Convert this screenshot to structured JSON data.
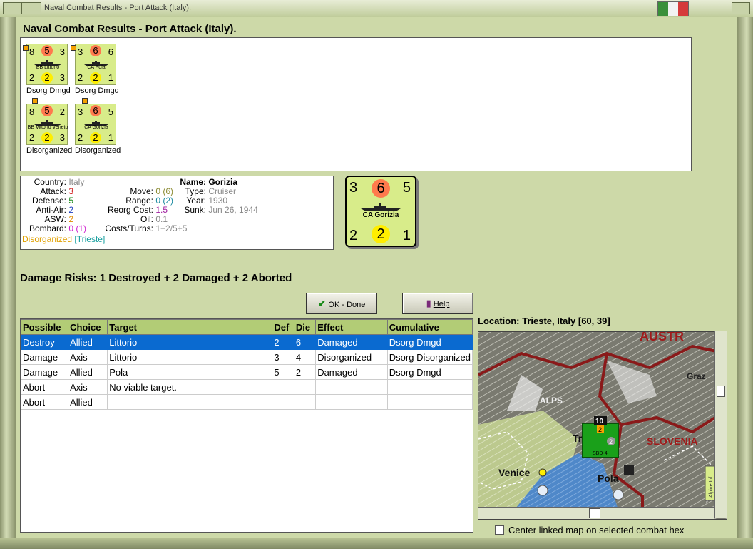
{
  "window": {
    "title": "Naval Combat Results - Port Attack (Italy).",
    "flag_colors": [
      "#3a8f3a",
      "#f2f2f2",
      "#d53a3a"
    ]
  },
  "heading": "Naval Combat Results - Port Attack (Italy).",
  "units": [
    {
      "atk": "8",
      "def": "5",
      "move": "3",
      "aa": "2",
      "asw": "2",
      "range": "3",
      "name": "BB Littorio",
      "status": "Dsorg Dmgd"
    },
    {
      "atk": "3",
      "def": "6",
      "move": "6",
      "aa": "2",
      "asw": "2",
      "range": "1",
      "name": "CA Pola",
      "status": "Dsorg Dmgd"
    },
    {
      "atk": "8",
      "def": "5",
      "move": "2",
      "aa": "2",
      "asw": "2",
      "range": "3",
      "name": "BB Vittorio Veneto",
      "status": "Disorganized"
    },
    {
      "atk": "3",
      "def": "6",
      "move": "5",
      "aa": "2",
      "asw": "2",
      "range": "1",
      "name": "CA Gorizia",
      "status": "Disorganized"
    }
  ],
  "info": {
    "country_label": "Country:",
    "country": "Italy",
    "attack_label": "Attack:",
    "attack": "3",
    "defense_label": "Defense:",
    "defense": "5",
    "antiair_label": "Anti-Air:",
    "antiair": "2",
    "asw_label": "ASW:",
    "asw": "2",
    "bombard_label": "Bombard:",
    "bombard": "0 (1)",
    "move_label": "Move:",
    "move": "0 (6)",
    "range_label": "Range:",
    "range": "0 (2)",
    "reorg_label": "Reorg Cost:",
    "reorg": "1.5",
    "oil_label": "Oil:",
    "oil": "0.1",
    "costs_label": "Costs/Turns:",
    "costs": "1+2/5+5",
    "name_label": "Name:",
    "name": "Gorizia",
    "type_label": "Type:",
    "type": "Cruiser",
    "year_label": "Year:",
    "year": "1930",
    "sunk_label": "Sunk:",
    "sunk": "Jun 26, 1944",
    "status": "Disorganized",
    "location": "[Trieste]"
  },
  "big_counter": {
    "atk": "3",
    "def": "6",
    "move": "5",
    "aa": "2",
    "asw": "2",
    "range": "1",
    "name": "CA Gorizia"
  },
  "risks": "Damage Risks:  1 Destroyed + 2 Damaged + 2 Aborted",
  "buttons": {
    "ok": "OK - Done",
    "help": "Help"
  },
  "table": {
    "headers": [
      "Possible",
      "Choice",
      "Target",
      "Def",
      "Die",
      "Effect",
      "Cumulative"
    ],
    "rows": [
      [
        "Destroy",
        "Allied",
        "Littorio",
        "2",
        "6",
        "Damaged",
        "Dsorg Dmgd"
      ],
      [
        "Damage",
        "Axis",
        "Littorio",
        "3",
        "4",
        "Disorganized",
        "Dsorg Disorganized"
      ],
      [
        "Damage",
        "Allied",
        "Pola",
        "5",
        "2",
        "Damaged",
        "Dsorg Dmgd"
      ],
      [
        "Abort",
        "Axis",
        "No viable target.",
        "",
        "",
        "",
        ""
      ],
      [
        "Abort",
        "Allied",
        "",
        "",
        "",
        "",
        ""
      ]
    ]
  },
  "location": "Location:  Trieste, Italy [60, 39]",
  "map": {
    "labels": {
      "austria": "AUSTR",
      "graz": "Graz",
      "alps": "ALPS",
      "slovenia": "SLOVENIA",
      "venice": "Venice",
      "pola": "Pola",
      "tr": "Tr",
      "alpine": "Alpine Inf"
    },
    "unit": {
      "top": "2",
      "mid": "2",
      "name": "SBD-4",
      "stack": "10"
    }
  },
  "center_checkbox": "Center linked map on selected combat hex"
}
